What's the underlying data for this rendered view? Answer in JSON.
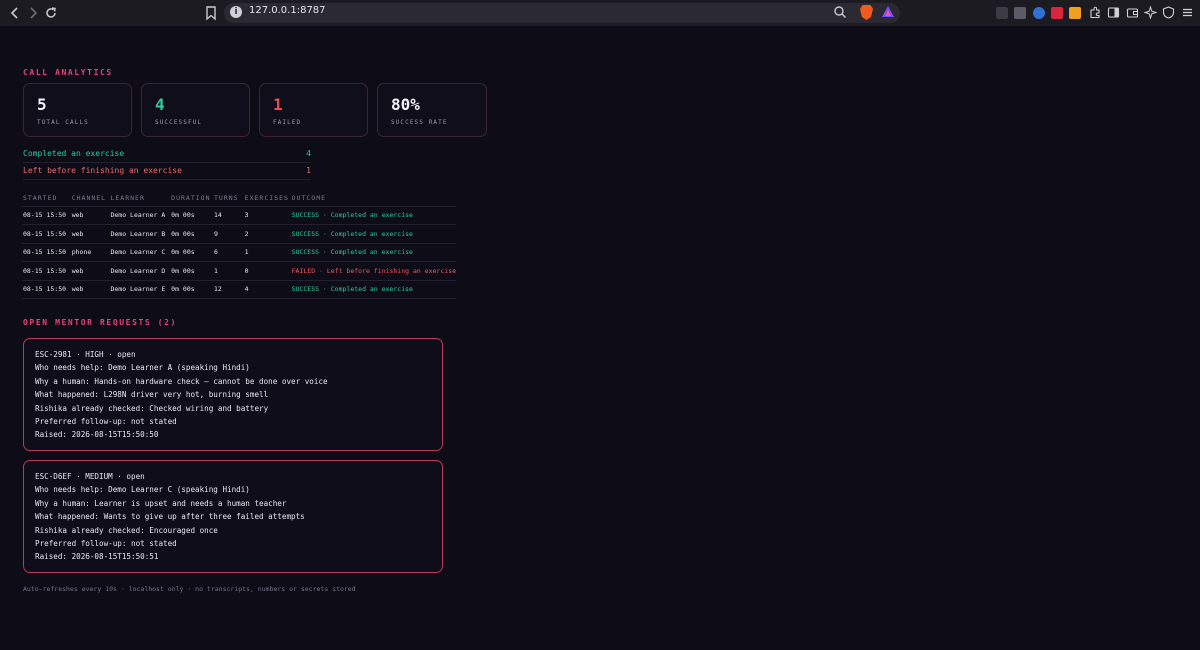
{
  "browser": {
    "url": "127.0.0.1:8787"
  },
  "analytics": {
    "title": "CALL ANALYTICS",
    "stats": [
      {
        "value": "5",
        "label": "TOTAL CALLS",
        "color": "#f3f2fa"
      },
      {
        "value": "4",
        "label": "SUCCESSFUL",
        "color": "#2ecc9a"
      },
      {
        "value": "1",
        "label": "FAILED",
        "color": "#ef4a52"
      },
      {
        "value": "80%",
        "label": "SUCCESS RATE",
        "color": "#f3f2fa"
      }
    ],
    "outcomes": [
      {
        "label": "Completed an exercise",
        "count": "4",
        "color": "#2ecc9a"
      },
      {
        "label": "Left before finishing an exercise",
        "count": "1",
        "color": "#ef6a6e"
      }
    ]
  },
  "table": {
    "headers": [
      "STARTED",
      "CHANNEL",
      "LEARNER",
      "DURATION",
      "TURNS",
      "EXERCISES",
      "OUTCOME"
    ],
    "rows": [
      {
        "started": "08-15 15:50",
        "channel": "web",
        "learner": "Demo Learner A",
        "duration": "0m 00s",
        "turns": "14",
        "exercises": "3",
        "outcome": "SUCCESS · Completed an exercise",
        "status": "success"
      },
      {
        "started": "08-15 15:50",
        "channel": "web",
        "learner": "Demo Learner B",
        "duration": "0m 00s",
        "turns": "9",
        "exercises": "2",
        "outcome": "SUCCESS · Completed an exercise",
        "status": "success"
      },
      {
        "started": "08-15 15:50",
        "channel": "phone",
        "learner": "Demo Learner C",
        "duration": "0m 00s",
        "turns": "6",
        "exercises": "1",
        "outcome": "SUCCESS · Completed an exercise",
        "status": "success"
      },
      {
        "started": "08-15 15:50",
        "channel": "web",
        "learner": "Demo Learner D",
        "duration": "0m 00s",
        "turns": "1",
        "exercises": "0",
        "outcome": "FAILED · Left before finishing an exercise",
        "status": "failed"
      },
      {
        "started": "08-15 15:50",
        "channel": "web",
        "learner": "Demo Learner E",
        "duration": "0m 00s",
        "turns": "12",
        "exercises": "4",
        "outcome": "SUCCESS · Completed an exercise",
        "status": "success"
      }
    ],
    "status_colors": {
      "success": "#2ecc9a",
      "failed": "#ef5a62"
    }
  },
  "requests": {
    "title": "OPEN MENTOR REQUESTS (2)",
    "cards": [
      {
        "lines": [
          "ESC-2981 · HIGH · open",
          "Who needs help: Demo Learner A (speaking Hindi)",
          "Why a human: Hands-on hardware check — cannot be done over voice",
          "What happened: L298N driver very hot, burning smell",
          "Rishika already checked: Checked wiring and battery",
          "Preferred follow-up: not stated",
          "Raised: 2026-08-15T15:50:50"
        ]
      },
      {
        "lines": [
          "ESC-D6EF · MEDIUM · open",
          "Who needs help: Demo Learner C (speaking Hindi)",
          "Why a human: Learner is upset and needs a human teacher",
          "What happened: Wants to give up after three failed attempts",
          "Rishika already checked: Encouraged once",
          "Preferred follow-up: not stated",
          "Raised: 2026-08-15T15:50:51"
        ]
      }
    ]
  },
  "footer": "Auto-refreshes every 10s · localhost only · no transcripts, numbers or secrets stored"
}
